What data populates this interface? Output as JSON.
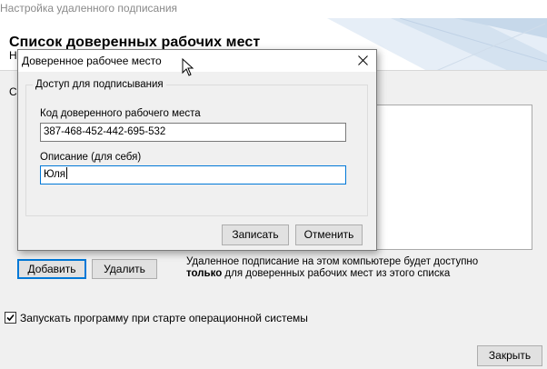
{
  "window": {
    "title": "Настройка удаленного подписания",
    "page_title": "Список доверенных рабочих мест",
    "page_subtitle_fragment": "Н",
    "left_fragment": "С"
  },
  "main": {
    "add_button": "Добавить",
    "remove_button": "Удалить",
    "info_line1": "Удаленное подписание на этом компьютере будет доступно",
    "info_bold": "только",
    "info_line2": " для доверенных рабочих мест из этого списка",
    "autostart_label": "Запускать программу при старте операционной системы",
    "autostart_checked": true,
    "close_button": "Закрыть"
  },
  "dialog": {
    "title": "Доверенное рабочее место",
    "group_label": "Доступ для подписывания",
    "code_label": "Код доверенного рабочего места",
    "code_value": "387-468-452-442-695-532",
    "description_label": "Описание (для себя)",
    "description_value": "Юля",
    "save_button": "Записать",
    "cancel_button": "Отменить"
  },
  "colors": {
    "accent": "#0078d7",
    "background": "#f0f0f0",
    "header_decor": "#dde8f3"
  }
}
